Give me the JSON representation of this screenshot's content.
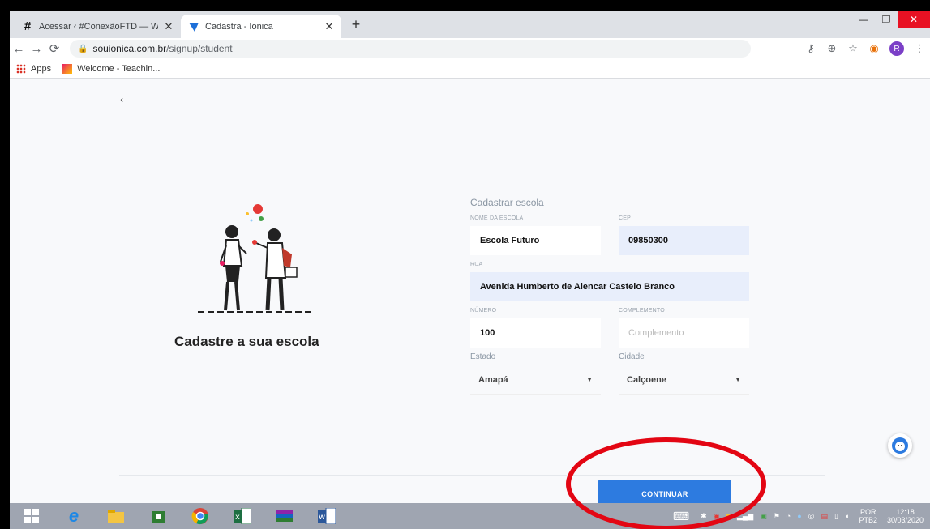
{
  "browser": {
    "tabs": [
      {
        "title": "Acessar ‹ #ConexãoFTD — Word",
        "icon": "hash-icon"
      },
      {
        "title": "Cadastra - Ionica",
        "icon": "ionica-icon"
      }
    ],
    "url_host": "souionica.com.br",
    "url_path": "/signup/student",
    "bookmarks": [
      {
        "label": "Apps"
      },
      {
        "label": "Welcome - Teachin..."
      }
    ],
    "profile_initial": "R"
  },
  "page": {
    "heading": "Cadastre a sua escola",
    "form": {
      "title": "Cadastrar escola",
      "fields": {
        "school_name": {
          "label": "NOME DA ESCOLA",
          "value": "Escola Futuro"
        },
        "cep": {
          "label": "CEP",
          "value": "09850300"
        },
        "street": {
          "label": "RUA",
          "value": "Avenida Humberto de Alencar Castelo Branco"
        },
        "number": {
          "label": "NÚMERO",
          "value": "100"
        },
        "complement": {
          "label": "COMPLEMENTO",
          "placeholder": "Complemento"
        },
        "state": {
          "label": "Estado",
          "value": "Amapá"
        },
        "city": {
          "label": "Cidade",
          "value": "Calçoene"
        }
      }
    },
    "continue_label": "CONTINUAR"
  },
  "taskbar": {
    "lang_top": "POR",
    "lang_bottom": "PTB2",
    "time": "12:18",
    "date": "30/03/2020"
  },
  "colors": {
    "accent": "#2d7be0",
    "annotation": "#e30613",
    "field_highlight": "#e8eefb"
  }
}
